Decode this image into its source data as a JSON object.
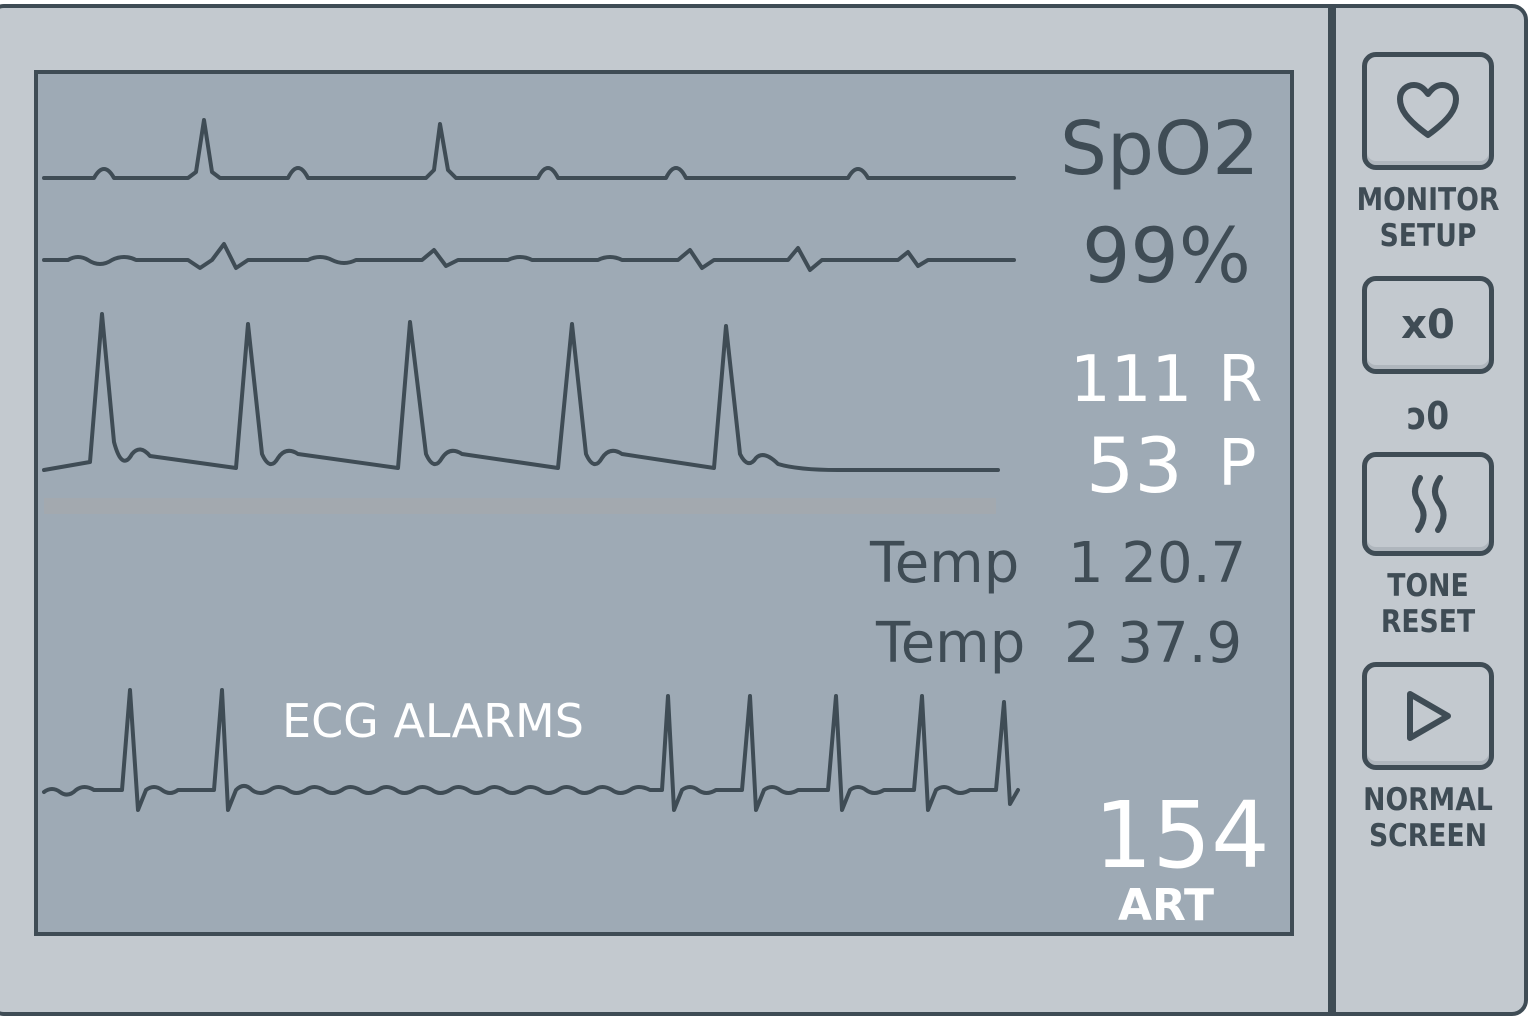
{
  "readouts": {
    "spo2_label": "SpO2",
    "spo2_value": "99%",
    "resp_value": "111",
    "resp_label": "R",
    "pulse_value": "53",
    "pulse_label": "P",
    "temp1_label": "Temp",
    "temp1_value": "1 20.7",
    "temp2_label": "Temp",
    "temp2_value": "2 37.9",
    "ecg_alarms": "ECG ALARMS",
    "art_value": "154",
    "art_label": "ART"
  },
  "side_panel": {
    "monitor_setup": {
      "line1": "MONITOR",
      "line2": "SETUP",
      "icon": "heart-icon"
    },
    "x0_button": {
      "label": "x0"
    },
    "x0_indicator": "ↄ0",
    "tone_reset": {
      "line1": "TONE",
      "line2": "RESET",
      "icon": "wave-icon"
    },
    "normal_screen": {
      "line1": "NORMAL",
      "line2": "SCREEN",
      "icon": "play-icon"
    }
  },
  "colors": {
    "bezel": "#c3c9cf",
    "screen": "#9eaab5",
    "outline": "#3f4c55",
    "text_light": "#ffffff"
  }
}
